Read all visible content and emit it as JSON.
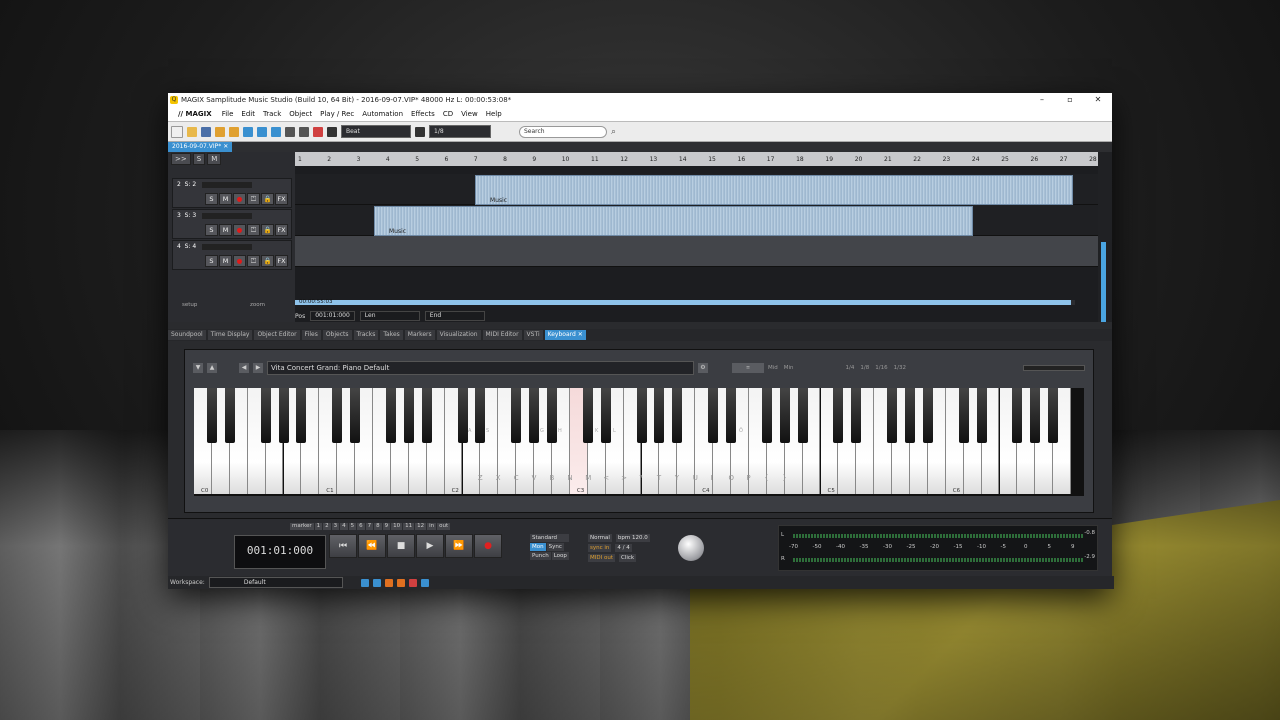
{
  "window": {
    "title": "MAGIX Samplitude Music Studio (Build 10, 64 Bit)  -  2016-09-07.VIP*   48000 Hz L: 00:00:53:08*",
    "controls": [
      "–",
      "▫",
      "✕"
    ]
  },
  "menu": {
    "brand": "// MAGIX",
    "items": [
      "File",
      "Edit",
      "Track",
      "Object",
      "Play / Rec",
      "Automation",
      "Effects",
      "CD",
      "View",
      "Help"
    ]
  },
  "toolbar": {
    "snap_mode": "Beat",
    "grid_value": "1/8",
    "search_placeholder": "Search"
  },
  "project_tab": "2016-09-07.VIP*",
  "arranger": {
    "header_buttons": [
      "S",
      "M"
    ],
    "ruler_ticks": [
      "1",
      "2",
      "3",
      "4",
      "5",
      "6",
      "7",
      "8",
      "9",
      "10",
      "11",
      "12",
      "13",
      "14",
      "15",
      "16",
      "17",
      "18",
      "19",
      "20",
      "21",
      "22",
      "23",
      "24",
      "25",
      "26",
      "27",
      "28"
    ],
    "tracks": [
      {
        "number": "2",
        "name": "S: 2",
        "buttons": [
          "S",
          "M",
          "●",
          "⏍",
          "🔒",
          "FX"
        ],
        "clip_label": "Music"
      },
      {
        "number": "3",
        "name": "S: 3",
        "buttons": [
          "S",
          "M",
          "●",
          "⏍",
          "🔒",
          "FX"
        ],
        "clip_label": "Music"
      },
      {
        "number": "4",
        "name": "S: 4",
        "buttons": [
          "S",
          "M",
          "●",
          "⏍",
          "🔒",
          "FX"
        ],
        "clip_label": ""
      }
    ],
    "setup_label": "setup",
    "zoom_label": "zoom",
    "scroll_time": "00:00:55:03",
    "pos_label": "Pos",
    "pos_value": "001:01:000",
    "len_label": "Len",
    "end_label": "End"
  },
  "dock_tabs": [
    "Soundpool",
    "Time Display",
    "Object Editor",
    "Files",
    "Objects",
    "Tracks",
    "Takes",
    "Markers",
    "Visualization",
    "MIDI Editor",
    "VSTi",
    "Keyboard"
  ],
  "keyboard": {
    "preset": "Vita Concert Grand: Piano Default",
    "note_options": [
      "Mid",
      "Min",
      "1/4",
      "1/8",
      "1/16",
      "1/32"
    ],
    "octave_labels": [
      "C0",
      "C1",
      "C2",
      "C3",
      "C4",
      "C5",
      "C6"
    ],
    "pc_keys_lower": [
      "|",
      "Z",
      "X",
      "C",
      "V",
      "B",
      "N",
      "M",
      "<",
      ">",
      "?",
      "T",
      "Y",
      "U",
      "I",
      "O",
      "P",
      "{",
      "}"
    ],
    "pc_keys_black": [
      "A",
      "S",
      "G",
      "H",
      "K",
      "L",
      "Ö"
    ]
  },
  "transport": {
    "time": "001:01:000",
    "marker_label": "marker",
    "marker_numbers": [
      "1",
      "2",
      "3",
      "4",
      "5",
      "6",
      "7",
      "8",
      "9",
      "10",
      "11",
      "12"
    ],
    "in_label": "in",
    "out_label": "out",
    "buttons": [
      "⏮",
      "⏪",
      "■",
      "▶",
      "⏩",
      "●"
    ],
    "mode": "Standard",
    "mon": "Mon",
    "sync": "Sync",
    "punch": "Punch",
    "loop": "Loop",
    "play_mode": "Normal",
    "bpm": "bpm 120.0",
    "signature": "4 / 4",
    "click": "Click",
    "sync_midi_1": "sync",
    "sync_midi_2": "MIDI",
    "sync_in": "in",
    "sync_out": "out"
  },
  "meter": {
    "scale": [
      "-70",
      "-50",
      "-40",
      "-35",
      "-30",
      "-25",
      "-20",
      "-15",
      "-10",
      "-5",
      "0",
      "5",
      "9"
    ],
    "left_value": "-0.8",
    "right_value": "-2.9",
    "channels": [
      "L",
      "R"
    ]
  },
  "status": {
    "workspace_label": "Workspace:",
    "workspace_value": "Default"
  },
  "colors": {
    "accent": "#3a90d0",
    "clip_wave": "#9ab7d2",
    "record": "#e01a1a"
  }
}
